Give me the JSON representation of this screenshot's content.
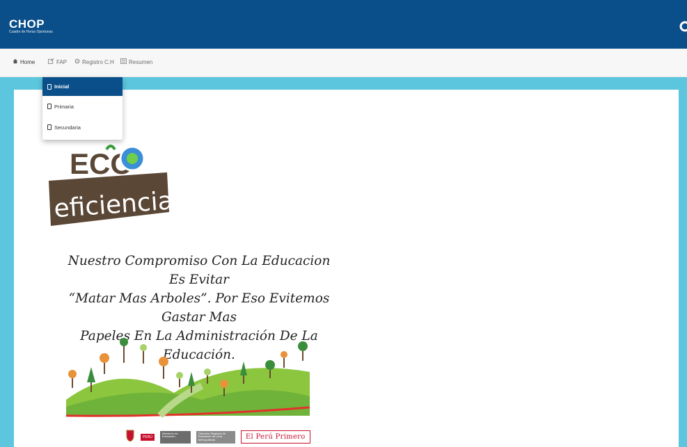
{
  "app": {
    "title": "CHOP",
    "subtitle": "Cuadro de Horas Oportunas"
  },
  "nav": [
    {
      "label": "Home",
      "icon": "home-icon"
    },
    {
      "label": "FAP",
      "icon": "edit-icon"
    },
    {
      "label": "Registro C.H",
      "icon": "gear-icon"
    },
    {
      "label": "Resumen",
      "icon": "list-icon"
    }
  ],
  "dropdown": [
    {
      "label": "Inicial",
      "active": true
    },
    {
      "label": "Primaria",
      "active": false
    },
    {
      "label": "Secundaria",
      "active": false
    }
  ],
  "logo": {
    "eco": "ECO",
    "eficiencia": "eficiencia"
  },
  "motto": {
    "line1": "Nuestro Compromiso Con La Educacion Es Evitar",
    "line2": "“Matar Mas Arboles”. Por Eso Evitemos Gastar Mas",
    "line3": "Papeles En La Administración De La Educación."
  },
  "footer": {
    "peru": "PERÚ",
    "ministry": "Ministerio de Educación",
    "regional": "Dirección Regional de Educación de Lima Metropolitana",
    "slogan": "El Perú Primero"
  },
  "colors": {
    "primary": "#0b4f8a",
    "teal": "#5bc6dd",
    "eco_brown": "#5a4736",
    "eco_green": "#3a9b3a",
    "peru_red": "#c8102e"
  }
}
